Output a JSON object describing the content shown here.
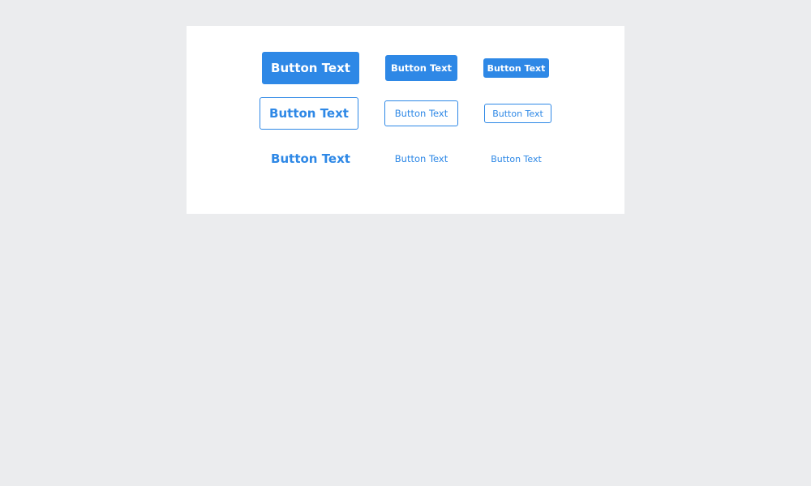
{
  "colors": {
    "page_background": "#ebecee",
    "card_background": "#ffffff",
    "accent": "#2e88e6",
    "on_accent": "#ffffff"
  },
  "buttons": {
    "filled": [
      {
        "size": "large",
        "label": "Button Text"
      },
      {
        "size": "medium",
        "label": "Button Text"
      },
      {
        "size": "small",
        "label": "Button Text"
      }
    ],
    "outline": [
      {
        "size": "large",
        "label": "Button Text"
      },
      {
        "size": "medium",
        "label": "Button Text"
      },
      {
        "size": "small",
        "label": "Button Text"
      }
    ],
    "text": [
      {
        "size": "large",
        "label": "Button Text"
      },
      {
        "size": "medium",
        "label": "Button Text"
      },
      {
        "size": "small",
        "label": "Button Text"
      }
    ]
  }
}
